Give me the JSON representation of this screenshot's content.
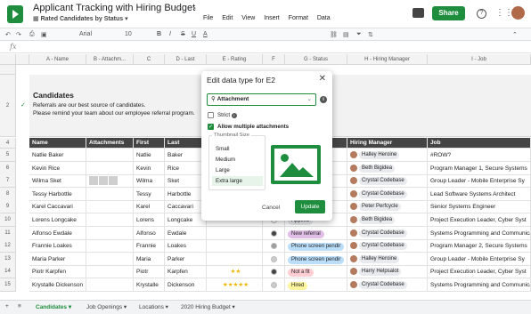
{
  "app": {
    "title": "Applicant Tracking with Hiring Budget",
    "view": "Rated Candidates by Status",
    "menu": [
      "File",
      "Edit",
      "View",
      "Insert",
      "Format",
      "Data"
    ],
    "share_label": "Share",
    "help_glyph": "?",
    "apps_glyph": "⋮⋮"
  },
  "toolbar": {
    "font": "Arial",
    "size": "10",
    "bold": "B",
    "italic": "I",
    "strike": "S",
    "underline": "U",
    "text_color": "A"
  },
  "formula": {
    "fx": "fx"
  },
  "columns": [
    {
      "label": "A - Name"
    },
    {
      "label": "B - Attachm..."
    },
    {
      "label": "C"
    },
    {
      "label": "D - Last"
    },
    {
      "label": "E - Rating"
    },
    {
      "label": "F"
    },
    {
      "label": "G - Status"
    },
    {
      "label": "H - Hiring Manager"
    },
    {
      "label": "I - Job"
    }
  ],
  "banner": {
    "title": "Candidates",
    "line1": "Referrals are our best source of candidates.",
    "line2": "Please remind your team about our employee referral program."
  },
  "header_row": [
    "Name",
    "Attachments",
    "First",
    "Last",
    "",
    "",
    "",
    "Hiring Manager",
    "Job"
  ],
  "rows": [
    {
      "num": "5",
      "name": "Natlie Baker",
      "first": "Natlie",
      "last": "Baker",
      "rating": "",
      "status": "",
      "dot": "#ffffff",
      "manager": "Halley Heroine",
      "job": "#ROW?",
      "attach": 0
    },
    {
      "num": "6",
      "name": "Kevin Rice",
      "first": "Kevin",
      "last": "Rice",
      "rating": "",
      "status": "",
      "dot": "#ffffff",
      "manager": "Beth Bigidea",
      "job": "Program Manager 1, Secure Systems",
      "attach": 0
    },
    {
      "num": "7",
      "name": "Wilma Sket",
      "first": "Wilma",
      "last": "Sket",
      "rating": "",
      "status": "",
      "dot": "#ffffff",
      "manager": "Crystal Codebase",
      "job": "Group Leader - Mobile Enterprise Sy",
      "attach": 3
    },
    {
      "num": "8",
      "name": "Tessy Harbottle",
      "first": "Tessy",
      "last": "Harbottle",
      "rating": "",
      "status": "",
      "dot": "#ffffff",
      "manager": "Crystal Codebase",
      "job": "Lead Software Systems Architect",
      "attach": 0
    },
    {
      "num": "9",
      "name": "Karel Caccavari",
      "first": "Karel",
      "last": "Caccavari",
      "rating": "",
      "status": "",
      "dot": "#ffffff",
      "manager": "Peter Perfcycle",
      "job": "Senior Systems Engineer",
      "attach": 0
    },
    {
      "num": "10",
      "name": "Lorens Longcake",
      "first": "Lorens",
      "last": "Longcake",
      "rating": "",
      "status": "Applied",
      "dot": "#ffffff",
      "manager": "Beth Bigidea",
      "job": "Project Execution Leader, Cyber Syst",
      "attach": 0
    },
    {
      "num": "11",
      "name": "Alfonso Ewdale",
      "first": "Alfonso",
      "last": "Ewdale",
      "rating": "",
      "status": "New referral",
      "dot": "#444444",
      "manager": "Crystal Codebase",
      "job": "Systems Programming and Communicatio",
      "attach": 0
    },
    {
      "num": "12",
      "name": "Frannie Loakes",
      "first": "Frannie",
      "last": "Loakes",
      "rating": "",
      "status": "Phone screen pendir",
      "dot": "#9e9e9e",
      "manager": "Crystal Codebase",
      "job": "Program Manager 2, Secure Systems",
      "attach": 0
    },
    {
      "num": "13",
      "name": "Maria Parker",
      "first": "Maria",
      "last": "Parker",
      "rating": "",
      "status": "Phone screen pendir",
      "dot": "#cccccc",
      "manager": "Halley Heroine",
      "job": "Group Leader - Mobile Enterprise Sy",
      "attach": 0
    },
    {
      "num": "14",
      "name": "Piotr Karpfen",
      "first": "Piotr",
      "last": "Karpfen",
      "rating": "★★",
      "status": "Not a fit",
      "dot": "#444444",
      "manager": "Harry Helpsalot",
      "job": "Project Execution Leader, Cyber Syst",
      "attach": 0
    },
    {
      "num": "15",
      "name": "Krystalle Dickenson",
      "first": "Krystalle",
      "last": "Dickenson",
      "rating": "★★★★★",
      "status": "Hired",
      "dot": "#cccccc",
      "manager": "Crystal Codebase",
      "job": "Systems Programming and Communicatio",
      "attach": 0
    }
  ],
  "status_colors": {
    "Applied": "#e8eaed",
    "New referral": "#e1bee7",
    "Phone screen pendir": "#bbdefb",
    "Not a fit": "#ffcdd2",
    "Hired": "#fff59d"
  },
  "tabs": [
    "Candidates",
    "Job Openings",
    "Locations",
    "2020 Hiring Budget"
  ],
  "modal": {
    "title": "Edit data type for E2",
    "type": "Attachment",
    "strict_label": "Strict",
    "multi_label": "Allow multiple attachments",
    "thumb_legend": "Thumbnail Size",
    "sizes": [
      "Small",
      "Medium",
      "Large",
      "Extra large"
    ],
    "selected": "Extra large",
    "cancel": "Cancel",
    "update": "Update"
  },
  "accent": "#1e8e3e"
}
